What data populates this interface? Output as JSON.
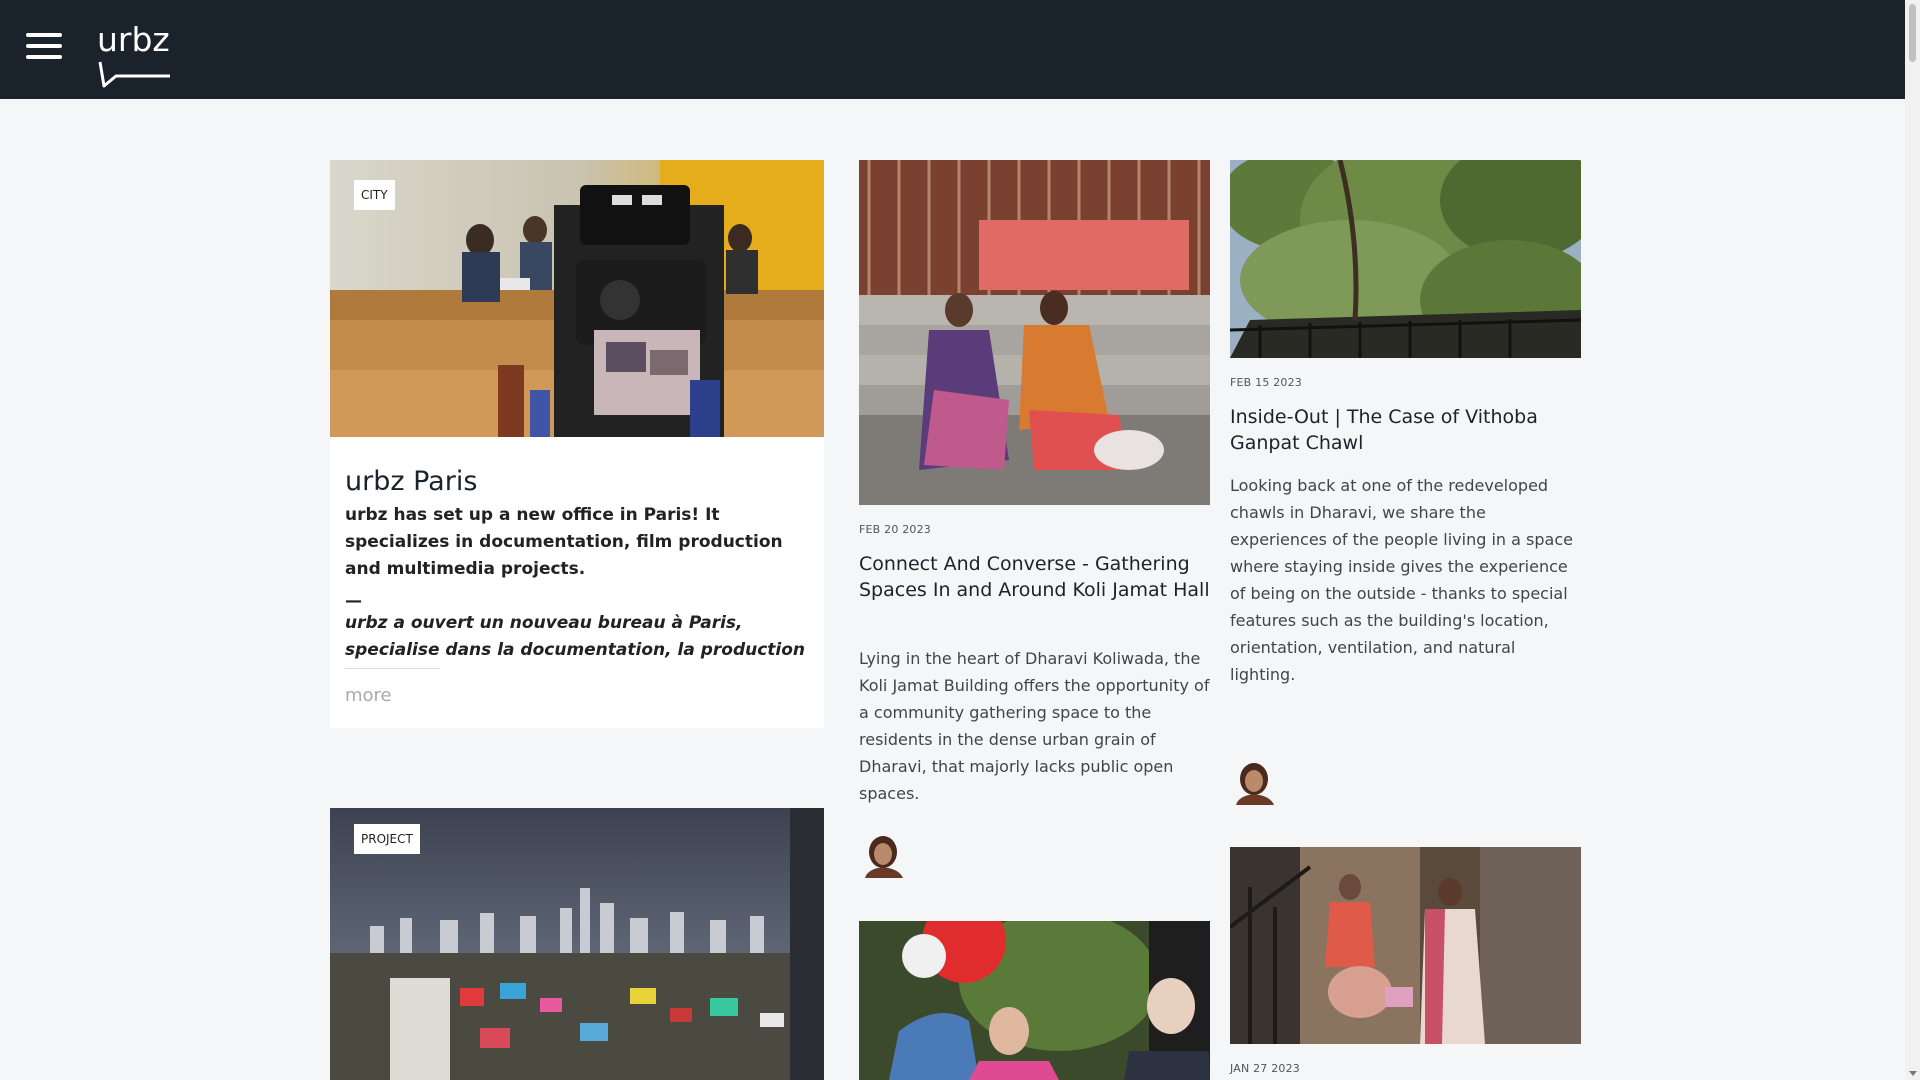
{
  "header": {
    "logo_text": "urbz",
    "menu_icon": "hamburger-menu-icon"
  },
  "cards": [
    {
      "tag": "CITY",
      "title": "urbz Paris",
      "lead": "urbz has set up a new office in Paris! It specializes in documentation, film production and multimedia projects.",
      "dash": "—",
      "italic": "urbz a ouvert un nouveau bureau à Paris, specialise dans la documentation, la production",
      "more": "more"
    },
    {
      "date": "FEB 20 2023",
      "title": "Connect And Converse - Gathering Spaces In and Around Koli Jamat Hall",
      "excerpt": "Lying in the heart of Dharavi Koliwada, the Koli Jamat Building offers the opportunity of a community gathering space to the residents in the dense urban grain of Dharavi, that majorly lacks public open spaces."
    },
    {
      "date": "FEB 15 2023",
      "title": "Inside-Out | The Case of Vithoba Ganpat Chawl",
      "excerpt": "Looking back at one of the redeveloped chawls in Dharavi, we share the experiences of the people living in a space where staying inside gives the experience of being on the outside - thanks to special features such as the building's location, orientation, ventilation, and natural lighting."
    },
    {
      "tag": "PROJECT"
    },
    {
      "date": "JAN 27 2023"
    }
  ]
}
